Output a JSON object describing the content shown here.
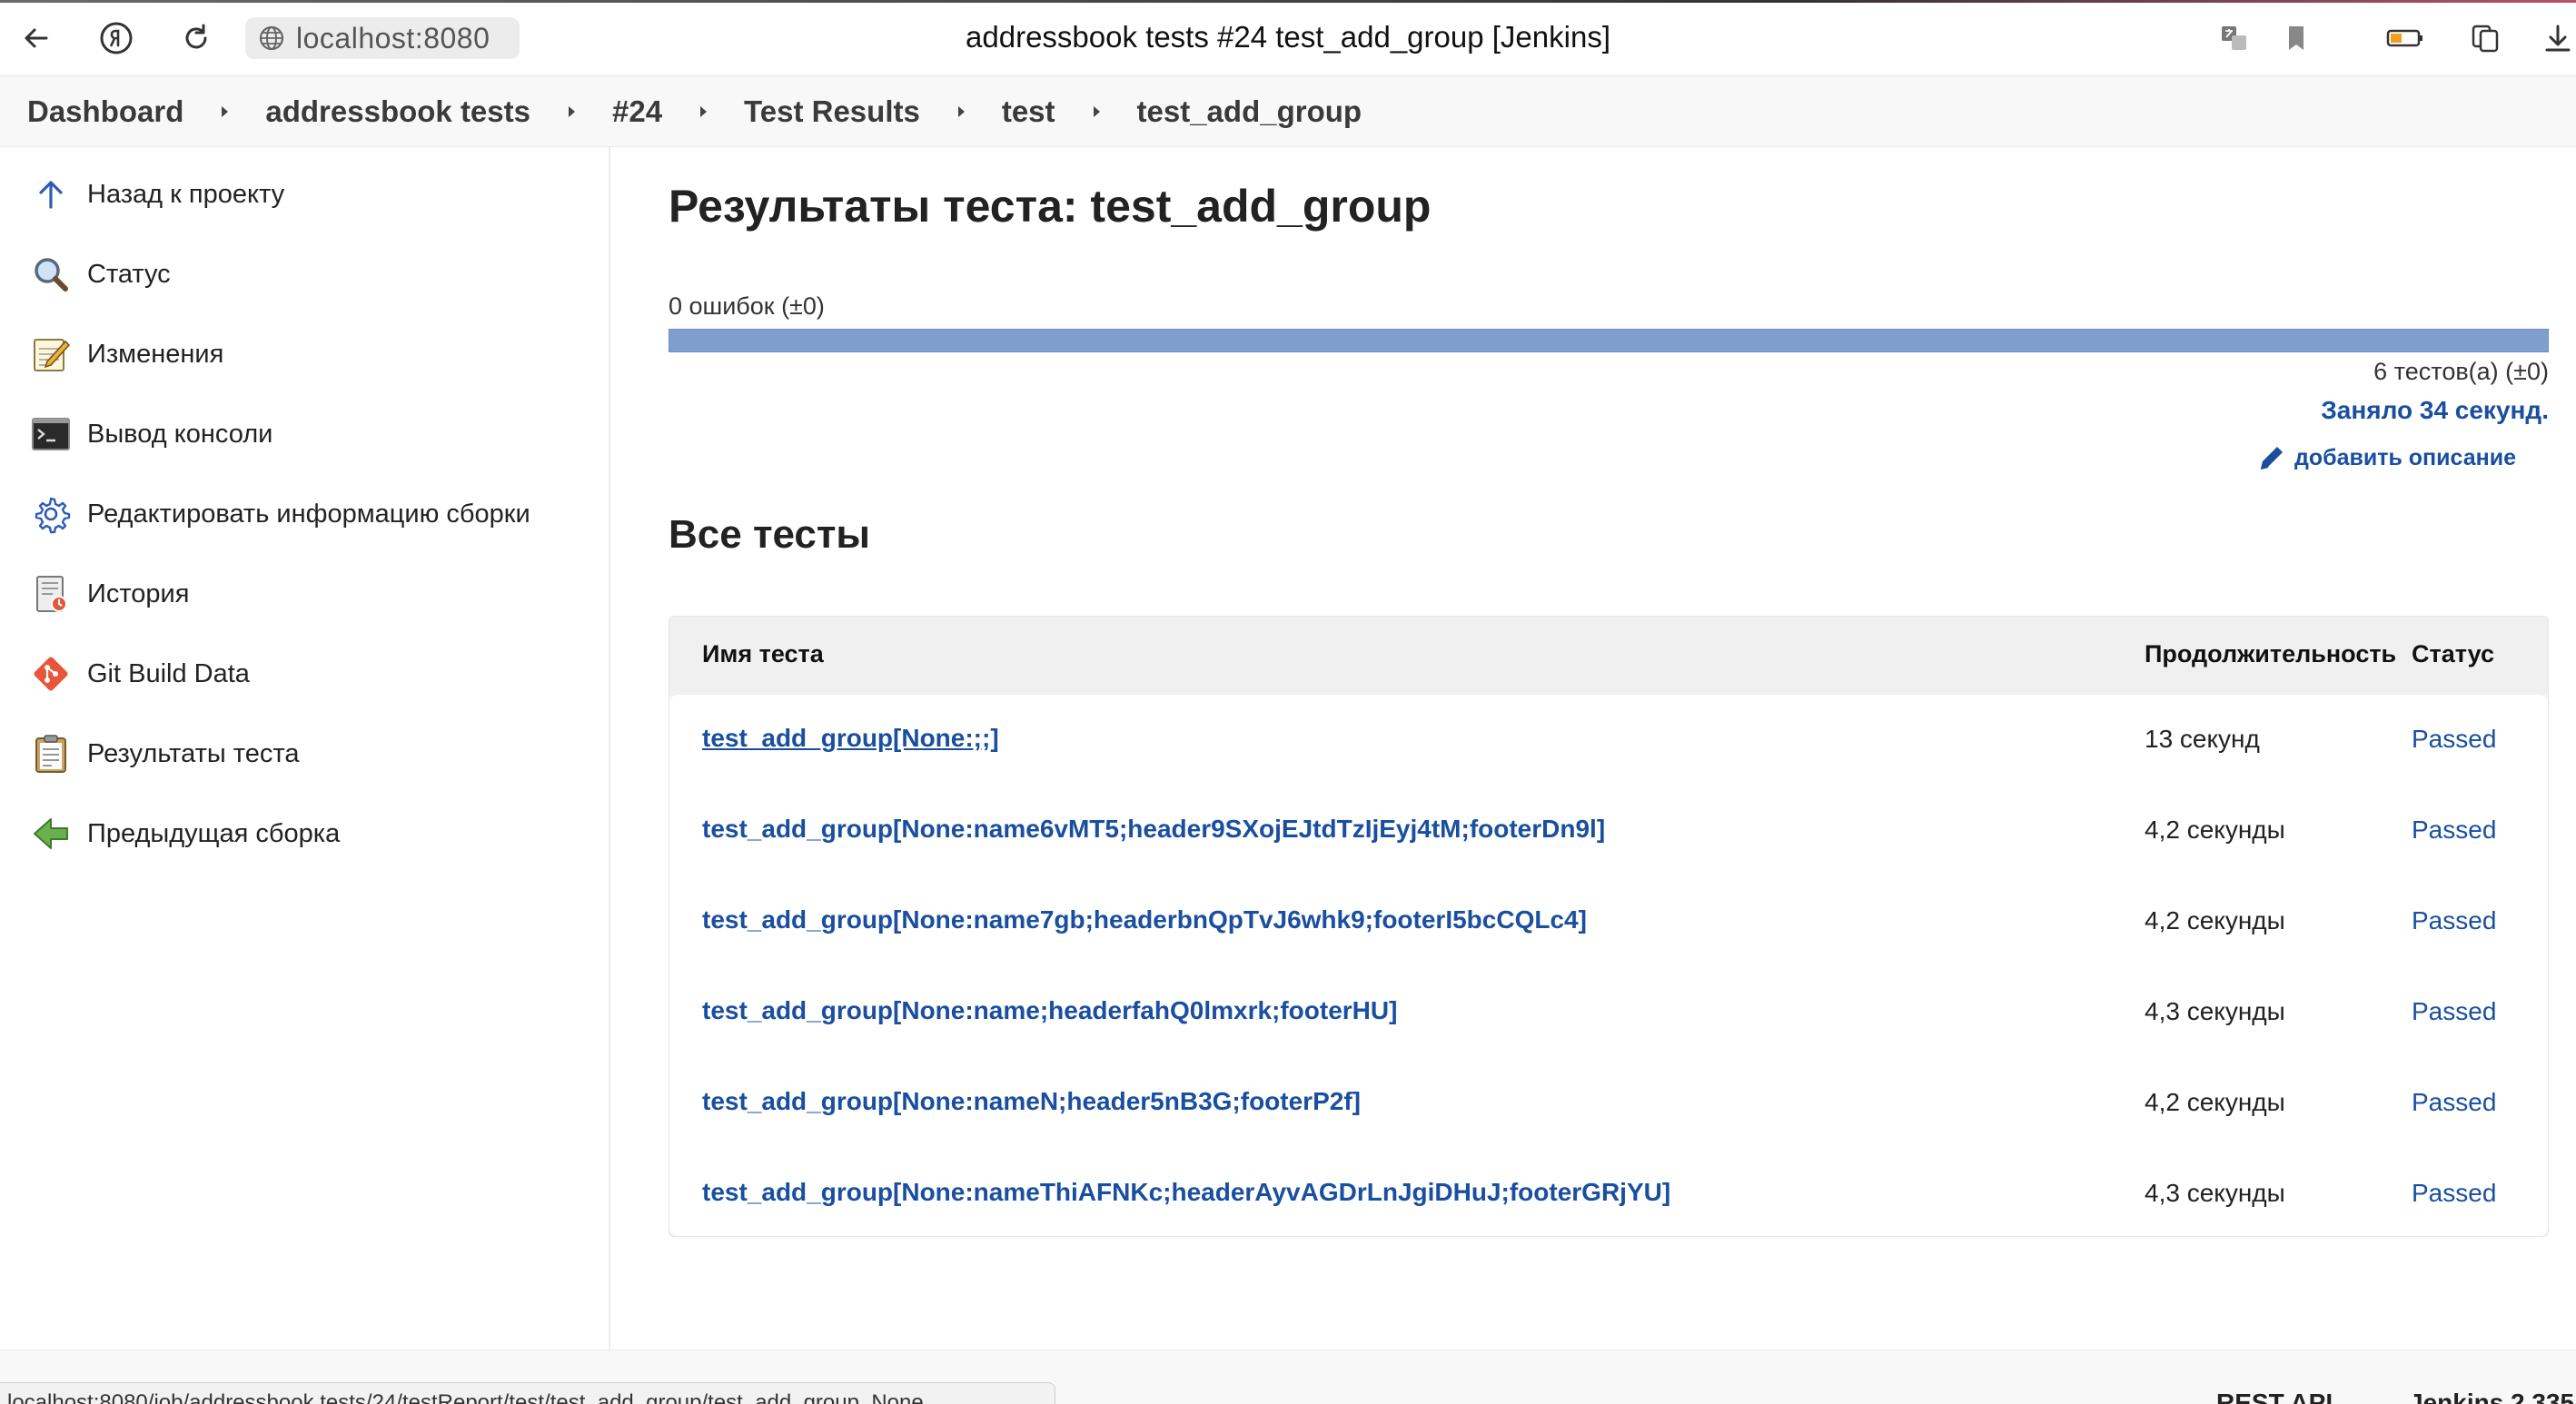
{
  "browser": {
    "url": "localhost:8080",
    "tab_title": "addressbook tests #24 test_add_group [Jenkins]"
  },
  "breadcrumbs": [
    {
      "label": "Dashboard"
    },
    {
      "label": "addressbook tests"
    },
    {
      "label": "#24"
    },
    {
      "label": "Test Results"
    },
    {
      "label": "test"
    },
    {
      "label": "test_add_group"
    }
  ],
  "sidebar": {
    "items": [
      {
        "label": "Назад к проекту",
        "icon": "arrow-up-icon"
      },
      {
        "label": "Статус",
        "icon": "magnifier-icon"
      },
      {
        "label": "Изменения",
        "icon": "notepad-icon"
      },
      {
        "label": "Вывод консоли",
        "icon": "terminal-icon"
      },
      {
        "label": "Редактировать информацию сборки",
        "icon": "gear-icon"
      },
      {
        "label": "История",
        "icon": "history-icon"
      },
      {
        "label": "Git Build Data",
        "icon": "git-icon"
      },
      {
        "label": "Результаты теста",
        "icon": "clipboard-icon"
      },
      {
        "label": "Предыдущая сборка",
        "icon": "arrow-left-icon"
      }
    ]
  },
  "main": {
    "title": "Результаты теста: test_add_group",
    "fail_count": "0 ошибок (±0)",
    "progress": {
      "failed_fraction": 0.0,
      "bar_color": "#7d9ecf"
    },
    "test_count": "6 тестов(а) (±0)",
    "duration_total": "Заняло 34 секунд.",
    "add_description": "добавить описание",
    "section_title": "Все тесты",
    "table": {
      "columns": [
        "Имя теста",
        "Продолжительность",
        "Статус"
      ],
      "rows": [
        {
          "name": "test_add_group[None:;;]",
          "duration": "13 секунд",
          "status": "Passed"
        },
        {
          "name": "test_add_group[None:name6vMT5;header9SXojEJtdTzIjEyj4tM;footerDn9l]",
          "duration": "4,2 секунды",
          "status": "Passed"
        },
        {
          "name": "test_add_group[None:name7gb;headerbnQpTvJ6whk9;footerI5bcCQLc4]",
          "duration": "4,2 секунды",
          "status": "Passed"
        },
        {
          "name": "test_add_group[None:name;headerfahQ0lmxrk;footerHU]",
          "duration": "4,3 секунды",
          "status": "Passed"
        },
        {
          "name": "test_add_group[None:nameN;header5nB3G;footerP2f]",
          "duration": "4,2 секунды",
          "status": "Passed"
        },
        {
          "name": "test_add_group[None:nameThiAFNKc;headerAyvAGDrLnJgiDHuJ;footerGRjYU]",
          "duration": "4,3 секунды",
          "status": "Passed"
        }
      ]
    }
  },
  "footer": {
    "rest_api": "REST API",
    "version": "Jenkins 2.335"
  },
  "statusbar": {
    "hover_url": "localhost:8080/job/addressbook tests/24/testReport/test/test_add_group/test_add_group_None"
  },
  "colors": {
    "link": "#1a4fa0",
    "progress_bar": "#7d9ecf"
  }
}
